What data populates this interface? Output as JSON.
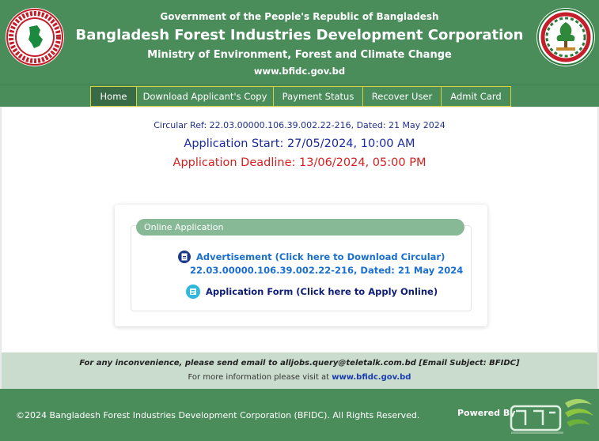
{
  "header": {
    "government": "Government of the People's Republic of Bangladesh",
    "org_name": "Bangladesh Forest Industries Development Corporation",
    "ministry": "Ministry of Environment, Forest and Climate Change",
    "website": "www.bfidc.gov.bd",
    "left_logo": "bangladesh-govt-seal",
    "right_logo": "bfidc-emblem"
  },
  "nav": {
    "items": [
      {
        "label": "Home",
        "active": true
      },
      {
        "label": "Download Applicant's Copy",
        "active": false
      },
      {
        "label": "Payment Status",
        "active": false
      },
      {
        "label": "Recover User",
        "active": false
      },
      {
        "label": "Admit Card",
        "active": false
      }
    ]
  },
  "notice": {
    "circular_ref": "Circular Ref: 22.03.00000.106.39.002.22-216, Dated: 21 May 2024",
    "start": "Application Start: 27/05/2024, 10:00 AM",
    "deadline": "Application Deadline: 13/06/2024, 05:00 PM"
  },
  "online_application": {
    "title": "Online Application",
    "advertisement_link": "Advertisement (Click here to Download Circular)",
    "advertisement_ref": "22.03.00000.106.39.002.22-216, Dated: 21 May 2024",
    "application_link": "Application Form (Click here to Apply Online)",
    "advertisement_icon": "pdf-document-icon",
    "application_icon": "form-icon"
  },
  "support": {
    "email_note": "For any inconvenience, please send email to alljobs.query@teletalk.com.bd [Email Subject: BFIDC]",
    "more_info_prefix": "For more information please visit at",
    "more_info_link": "www.bfidc.gov.bd"
  },
  "footer": {
    "copyright": "©2024 Bangladesh Forest Industries Development Corporation (BFIDC). All Rights Reserved.",
    "powered_by": "Powered By",
    "powered_logo": "teletalk-logo"
  },
  "colors": {
    "header_green": "#4b8c5b",
    "nav_border": "#d7d43a",
    "deadline_red": "#d62020",
    "link_blue": "#1a6fcf"
  }
}
